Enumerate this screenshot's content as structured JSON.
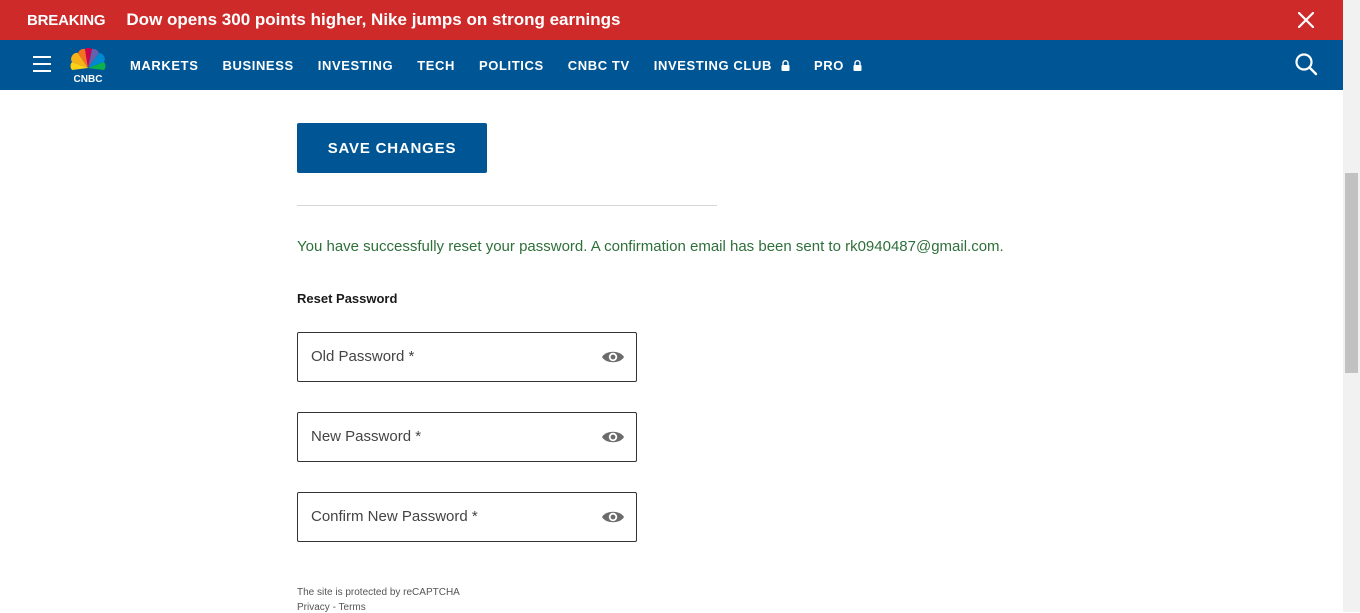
{
  "breaking": {
    "label": "BREAKING",
    "headline": "Dow opens 300 points higher, Nike jumps on strong earnings"
  },
  "nav": {
    "items": [
      {
        "label": "MARKETS",
        "locked": false
      },
      {
        "label": "BUSINESS",
        "locked": false
      },
      {
        "label": "INVESTING",
        "locked": false
      },
      {
        "label": "TECH",
        "locked": false
      },
      {
        "label": "POLITICS",
        "locked": false
      },
      {
        "label": "CNBC TV",
        "locked": false
      },
      {
        "label": "INVESTING CLUB",
        "locked": true
      },
      {
        "label": "PRO",
        "locked": true
      }
    ]
  },
  "form": {
    "save_label": "SAVE CHANGES",
    "success_message": "You have successfully reset your password. A confirmation email has been sent to rk0940487@gmail.com.",
    "section_title": "Reset Password",
    "fields": [
      {
        "label": "Old Password *"
      },
      {
        "label": "New Password *"
      },
      {
        "label": "Confirm New Password *"
      }
    ]
  },
  "recaptcha": {
    "notice": "The site is protected by reCAPTCHA",
    "privacy": "Privacy",
    "separator": " - ",
    "terms": "Terms"
  },
  "colors": {
    "breaking_bg": "#cf2a2a",
    "nav_bg": "#005594",
    "primary_button": "#005594",
    "success_text": "#2f6f3a"
  }
}
